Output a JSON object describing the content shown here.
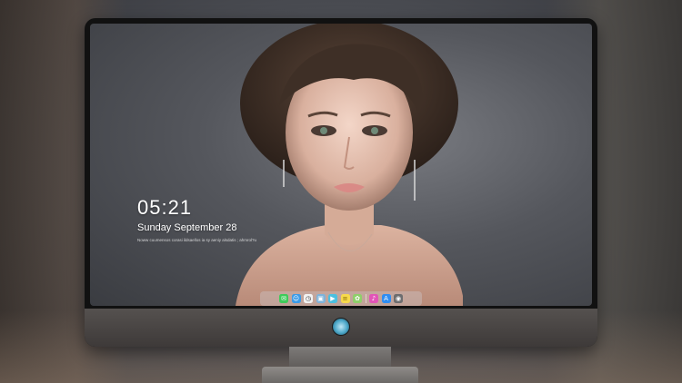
{
  "clock": {
    "time": "05:21",
    "date": "Sunday September  28",
    "note": "Noww cuumensos corasi ildsaellos ia sy aeniy alsdatis ; ahmrol?u"
  },
  "dock": {
    "apps": [
      {
        "name": "messages-icon",
        "glyph": "✉",
        "color": "#3ecb5a"
      },
      {
        "name": "finder-icon",
        "glyph": "☺",
        "color": "#3a9be8"
      },
      {
        "name": "clock-app-icon",
        "glyph": "◷",
        "color": "#f2f2f2"
      },
      {
        "name": "preview-icon",
        "glyph": "▣",
        "color": "#7fb3d9"
      },
      {
        "name": "imovie-icon",
        "glyph": "▶",
        "color": "#4cc0e0"
      },
      {
        "name": "notes-icon",
        "glyph": "≡",
        "color": "#f7d94c"
      },
      {
        "name": "photos-icon",
        "glyph": "✿",
        "color": "#8fcf6a"
      },
      {
        "name": "music-icon",
        "glyph": "♪",
        "color": "#e254b7"
      },
      {
        "name": "app-store-icon",
        "glyph": "A",
        "color": "#2f8df2"
      },
      {
        "name": "camera-icon",
        "glyph": "◉",
        "color": "#6d6d6f"
      }
    ]
  },
  "colors": {
    "screen_bg": "#55575d",
    "text": "#ffffff"
  }
}
